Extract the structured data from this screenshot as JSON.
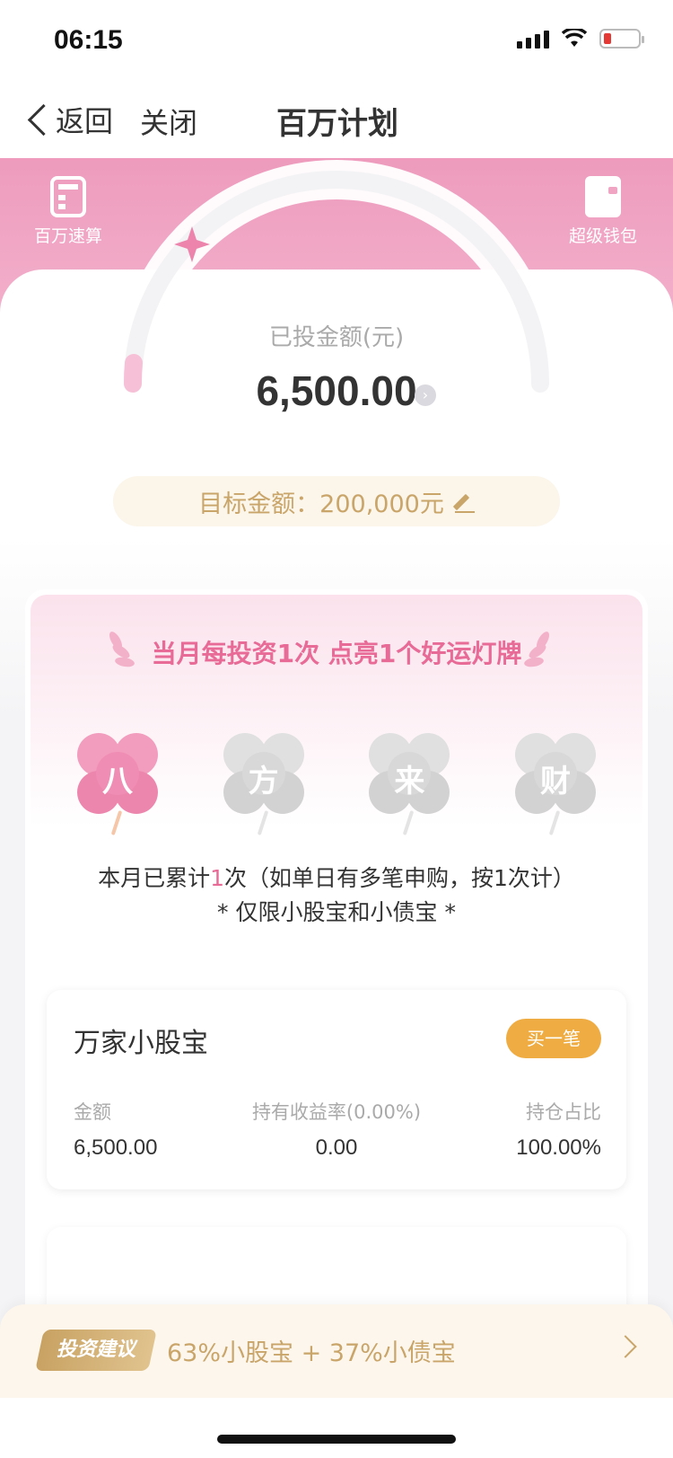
{
  "status_bar": {
    "time": "06:15"
  },
  "nav": {
    "back_label": "返回",
    "close_label": "关闭",
    "title": "百万计划"
  },
  "tools": {
    "left_label": "百万速算",
    "right_label": "超级钱包"
  },
  "gauge": {
    "label": "已投金额(元)",
    "amount": "6,500.00",
    "progress_fraction": 0.0325
  },
  "target": {
    "text": "目标金额：200,000元"
  },
  "banner": {
    "title": "当月每投资1次 点亮1个好运灯牌"
  },
  "lanterns": [
    {
      "char": "八",
      "lit": true
    },
    {
      "char": "方",
      "lit": false
    },
    {
      "char": "来",
      "lit": false
    },
    {
      "char": "财",
      "lit": false
    }
  ],
  "count": {
    "prefix": "本月已累计",
    "num": "1",
    "suffix": "次（如单日有多笔申购，按1次计）",
    "limit": "* 仅限小股宝和小债宝 *"
  },
  "product": {
    "name": "万家小股宝",
    "buy_label": "买一笔",
    "stats": [
      {
        "key": "金额",
        "value": "6,500.00"
      },
      {
        "key": "持有收益率(0.00%)",
        "value": "0.00"
      },
      {
        "key": "持仓占比",
        "value": "100.00%"
      }
    ]
  },
  "suggestion": {
    "tag": "投资建议",
    "text": "63%小股宝 + 37%小债宝"
  },
  "colors": {
    "pink": "#e86a97",
    "gold": "#c9a56a",
    "orange": "#eeac42"
  }
}
